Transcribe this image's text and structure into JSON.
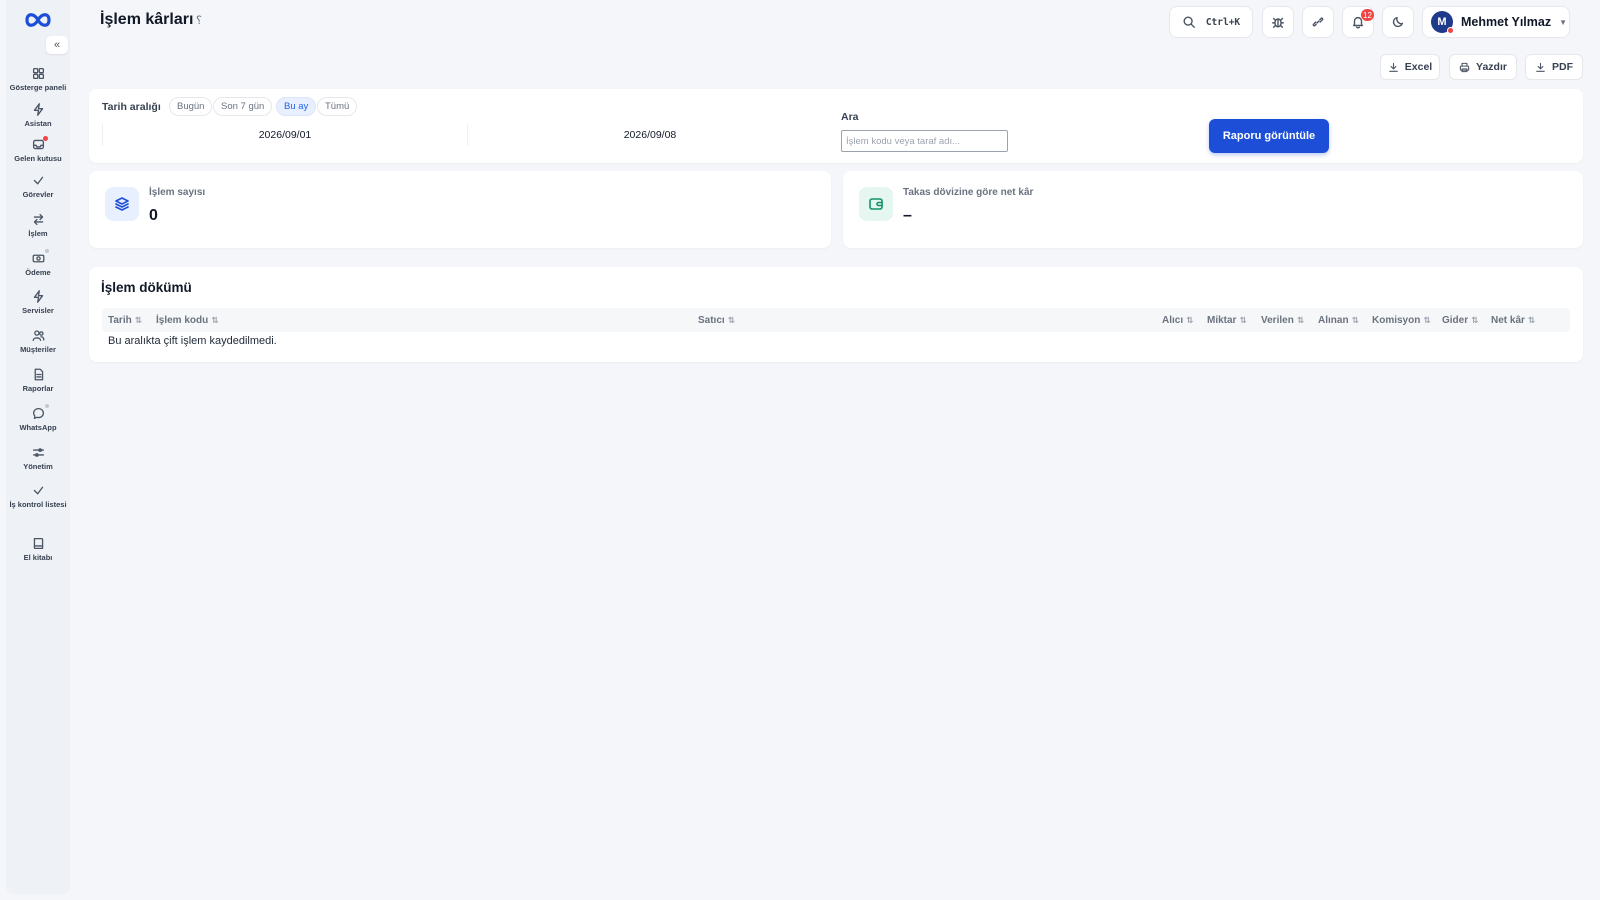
{
  "sidebar": {
    "collapse_label": "«",
    "items": [
      {
        "label": "Gösterge paneli",
        "icon": "grid-icon"
      },
      {
        "label": "Asistan",
        "icon": "bolt-icon"
      },
      {
        "label": "Gelen kutusu",
        "icon": "inbox-icon"
      },
      {
        "label": "Görevler",
        "icon": "check-icon"
      },
      {
        "label": "İşlem",
        "icon": "swap-icon"
      },
      {
        "label": "Ödeme",
        "icon": "cash-icon"
      },
      {
        "label": "Servisler",
        "icon": "bolt-icon"
      },
      {
        "label": "Müşteriler",
        "icon": "users-icon"
      },
      {
        "label": "Raporlar",
        "icon": "file-icon"
      },
      {
        "label": "WhatsApp",
        "icon": "chat-icon"
      },
      {
        "label": "Yönetim",
        "icon": "sliders-icon"
      },
      {
        "label": "İş kontrol listesi",
        "icon": "check-icon"
      },
      {
        "label": "El kitabı",
        "icon": "book-icon"
      }
    ]
  },
  "header": {
    "title": "İşlem kârları",
    "title_hint": "؟",
    "search_shortcut": "Ctrl+K",
    "notification_count": "12",
    "user": {
      "initial": "M",
      "name": "Mehmet Yılmaz",
      "caret": "▼"
    }
  },
  "exports": {
    "excel": "Excel",
    "print": "Yazdır",
    "pdf": "PDF"
  },
  "filters": {
    "date_range_label": "Tarih aralığı",
    "presets": [
      "Bugün",
      "Son 7 gün",
      "Bu ay",
      "Tümü"
    ],
    "active_preset": "Bu ay",
    "start_date": "2026/09/01",
    "end_date": "2026/09/08",
    "search_label": "Ara",
    "search_placeholder": "İşlem kodu veya taraf adı...",
    "search_value": "",
    "submit_label": "Raporu görüntüle"
  },
  "stats": {
    "count_label": "İşlem sayısı",
    "count_value": "0",
    "profit_label": "Takas dövizine göre net kâr",
    "profit_value": "–"
  },
  "table": {
    "title": "İşlem dökümü",
    "sort_glyph": "⇅",
    "columns": [
      "Tarih",
      "İşlem kodu",
      "Satıcı",
      "Alıcı",
      "Miktar",
      "Verilen",
      "Alınan",
      "Komisyon",
      "Gider",
      "Net kâr"
    ],
    "empty_message": "Bu aralıkta çift işlem kaydedilmedi."
  },
  "colors": {
    "accent": "#1d4ed8",
    "badge": "#ef4444",
    "background": "#f4f6fa"
  }
}
